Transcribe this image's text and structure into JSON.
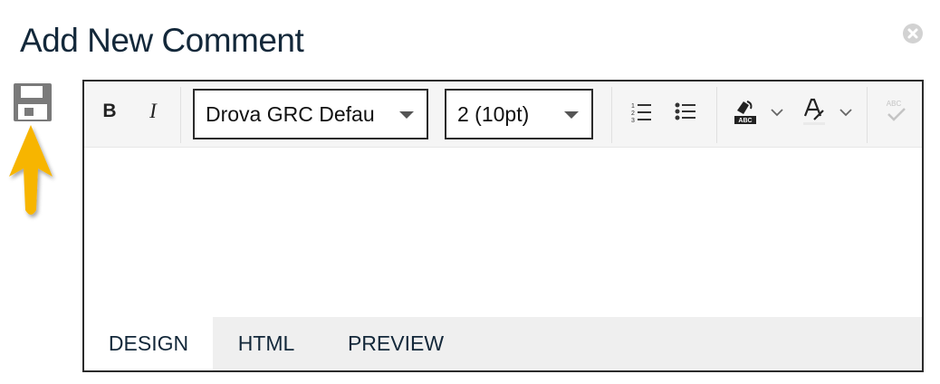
{
  "dialog": {
    "title": "Add New Comment",
    "close_icon": "close-circle-icon",
    "save_icon": "floppy-disk-icon"
  },
  "toolbar": {
    "bold_label": "B",
    "italic_label": "I",
    "font_family_value": "Drova GRC Defau",
    "font_size_value": "2 (10pt)",
    "icons": [
      "ordered-list-icon",
      "unordered-list-icon",
      "highlight-color-icon",
      "font-color-icon",
      "spellcheck-icon"
    ],
    "highlight_badge": "ABC",
    "spellcheck_badge": "ABC"
  },
  "tabs": [
    {
      "label": "DESIGN",
      "active": true
    },
    {
      "label": "HTML",
      "active": false
    },
    {
      "label": "PREVIEW",
      "active": false
    }
  ],
  "colors": {
    "annotation_arrow": "#f7b500",
    "title": "#13283a",
    "border": "#2b2b2b"
  }
}
